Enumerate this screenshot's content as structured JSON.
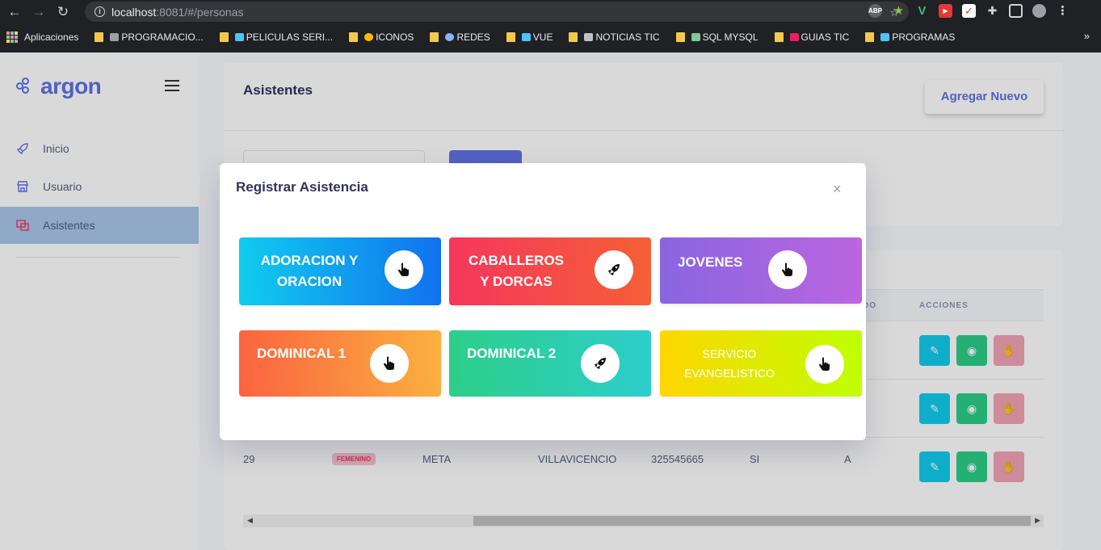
{
  "browser": {
    "url_host": "localhost",
    "url_path": ":8081/#/personas",
    "bookmarks": [
      {
        "label": "Aplicaciones"
      },
      {
        "label": "PROGRAMACIO..."
      },
      {
        "label": "PELICULAS SERI..."
      },
      {
        "label": "ICONOS"
      },
      {
        "label": "REDES"
      },
      {
        "label": "VUE"
      },
      {
        "label": "NOTICIAS TIC"
      },
      {
        "label": "SQL MYSQL"
      },
      {
        "label": "GUIAS TIC"
      },
      {
        "label": "PROGRAMAS"
      }
    ],
    "ext_abp": "ABP"
  },
  "sidebar": {
    "brand": "argon",
    "items": [
      {
        "label": "Inicio",
        "icon": "rocket-icon"
      },
      {
        "label": "Usuario",
        "icon": "shop-icon"
      },
      {
        "label": "Asistentes",
        "icon": "tv-icon"
      }
    ]
  },
  "header": {
    "title": "Asistentes",
    "add_button": "Agregar Nuevo"
  },
  "table": {
    "headers": [
      "DO",
      "ACCIONES"
    ],
    "rows": [
      {
        "id": "",
        "gender": "",
        "dept": "",
        "city": "",
        "phone": "",
        "flag": "",
        "status": ""
      },
      {
        "id": "",
        "gender": "",
        "dept": "",
        "city": "",
        "phone": "",
        "flag": "",
        "status": ""
      },
      {
        "id": "29",
        "gender": "FEMENINO",
        "dept": "META",
        "city": "VILLAVICENCIO",
        "phone": "325545665",
        "flag": "SI",
        "status": "A"
      }
    ]
  },
  "modal": {
    "title": "Registrar Asistencia",
    "close": "×",
    "tiles": [
      {
        "label": "ADORACION Y ORACION",
        "icon": "hand-pointer-icon"
      },
      {
        "label": "CABALLEROS Y DORCAS",
        "icon": "rocket-icon"
      },
      {
        "label": "JOVENES",
        "icon": "hand-pointer-icon"
      },
      {
        "label": "DOMINICAL 1",
        "icon": "hand-pointer-icon"
      },
      {
        "label": "DOMINICAL 2",
        "icon": "rocket-icon"
      },
      {
        "label": "SERVICIO EVANGELISTICO",
        "icon": "hand-pointer-icon"
      }
    ]
  },
  "colors": {
    "primary": "#5e72e4",
    "info": "#11cdef",
    "success": "#2dce89",
    "danger": "#f5365c"
  }
}
